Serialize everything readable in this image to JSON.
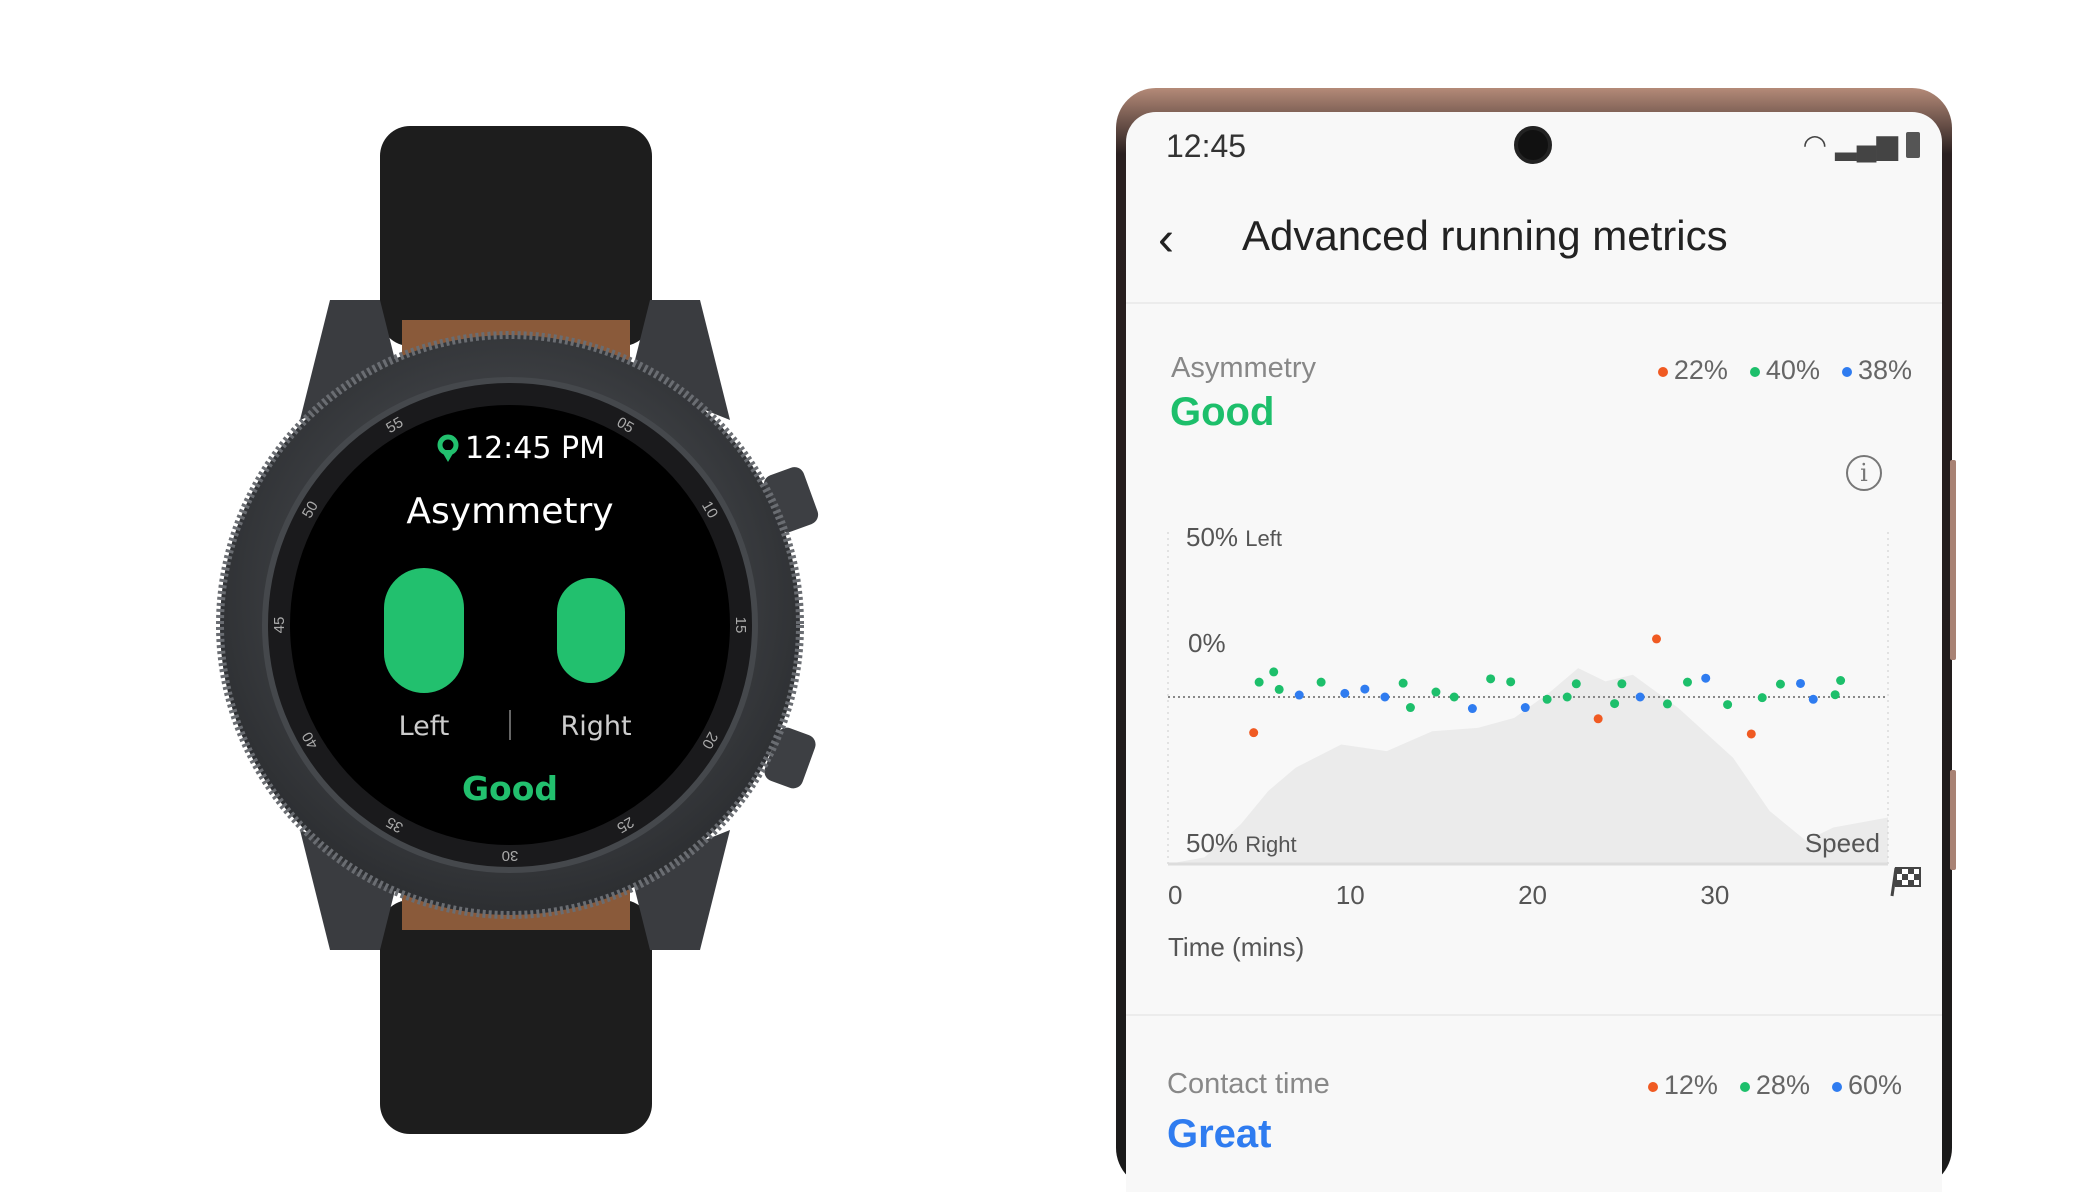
{
  "watch": {
    "time": "12:45 PM",
    "title": "Asymmetry",
    "left_label": "Left",
    "right_label": "Right",
    "status": "Good",
    "bezel_numbers": [
      "05",
      "10",
      "15",
      "20",
      "25",
      "30",
      "35",
      "40",
      "45",
      "50",
      "55"
    ],
    "icons": [
      "location-pin-icon"
    ],
    "colors": {
      "accent": "#22c06e"
    }
  },
  "phone": {
    "status_bar": {
      "time": "12:45",
      "icons": [
        "wifi-icon",
        "signal-icon",
        "battery-icon"
      ]
    },
    "header": {
      "title": "Advanced running metrics",
      "back_icon": "chevron-left-icon"
    },
    "asymmetry": {
      "label": "Asymmetry",
      "status": "Good",
      "status_color": "#1dbf6b",
      "legend": [
        {
          "value": "22%",
          "color": "#f05a22"
        },
        {
          "value": "40%",
          "color": "#1dbf6b"
        },
        {
          "value": "38%",
          "color": "#2f7cf0"
        }
      ],
      "info_icon": "info-icon"
    },
    "contact_time": {
      "label": "Contact time",
      "status": "Great",
      "status_color": "#2f7cf0",
      "legend": [
        {
          "value": "12%",
          "color": "#f05a22"
        },
        {
          "value": "28%",
          "color": "#1dbf6b"
        },
        {
          "value": "60%",
          "color": "#2f7cf0"
        }
      ]
    }
  },
  "chart_data": {
    "type": "scatter",
    "xlabel": "Time (mins)",
    "x_ticks": [
      "0",
      "10",
      "20",
      "30"
    ],
    "end_icon": "checkered-flag-icon",
    "y_labels": {
      "top": "50%",
      "top_suffix": "Left",
      "middle": "0%",
      "bottom": "50%",
      "bottom_suffix": "Right",
      "area": "Speed"
    },
    "xlim": [
      0,
      39.5
    ],
    "ylim": [
      -50,
      50
    ],
    "series": [
      {
        "color": "#f05a22",
        "points": [
          [
            4.7,
            -10.8
          ],
          [
            23.6,
            -6.6
          ],
          [
            26.8,
            17.6
          ],
          [
            32.0,
            -11.2
          ]
        ]
      },
      {
        "color": "#1dbf6b",
        "points": [
          [
            5.0,
            4.5
          ],
          [
            5.8,
            7.6
          ],
          [
            6.1,
            2.3
          ],
          [
            8.4,
            4.5
          ],
          [
            12.9,
            4.2
          ],
          [
            13.3,
            -3.2
          ],
          [
            14.7,
            1.5
          ],
          [
            15.7,
            0
          ],
          [
            17.7,
            5.5
          ],
          [
            18.8,
            4.6
          ],
          [
            20.8,
            -0.7
          ],
          [
            21.9,
            0
          ],
          [
            22.4,
            4.0
          ],
          [
            24.5,
            -2.0
          ],
          [
            24.9,
            4.0
          ],
          [
            27.4,
            -2.1
          ],
          [
            28.5,
            4.5
          ],
          [
            30.7,
            -2.3
          ],
          [
            32.6,
            -0.2
          ],
          [
            33.6,
            3.9
          ],
          [
            36.6,
            0.7
          ],
          [
            36.9,
            5.0
          ]
        ]
      },
      {
        "color": "#2f7cf0",
        "points": [
          [
            7.2,
            0.6
          ],
          [
            9.7,
            1.1
          ],
          [
            10.8,
            2.4
          ],
          [
            11.9,
            0
          ],
          [
            16.7,
            -3.5
          ],
          [
            19.6,
            -3.2
          ],
          [
            25.9,
            0
          ],
          [
            29.5,
            5.7
          ],
          [
            34.7,
            4.1
          ],
          [
            35.4,
            -0.7
          ]
        ]
      }
    ],
    "speed_area": {
      "color": "#ebebeb",
      "points": [
        [
          0,
          0
        ],
        [
          2,
          2
        ],
        [
          4,
          12
        ],
        [
          5.5,
          22
        ],
        [
          7,
          29
        ],
        [
          9.5,
          36
        ],
        [
          12,
          34
        ],
        [
          14.5,
          40
        ],
        [
          17,
          41
        ],
        [
          19,
          44
        ],
        [
          21,
          52
        ],
        [
          22.5,
          59
        ],
        [
          24,
          55
        ],
        [
          25.5,
          57
        ],
        [
          28,
          47
        ],
        [
          31,
          32
        ],
        [
          33,
          16
        ],
        [
          35,
          7
        ],
        [
          36.5,
          11
        ],
        [
          39.5,
          14
        ]
      ]
    },
    "grid": false
  }
}
